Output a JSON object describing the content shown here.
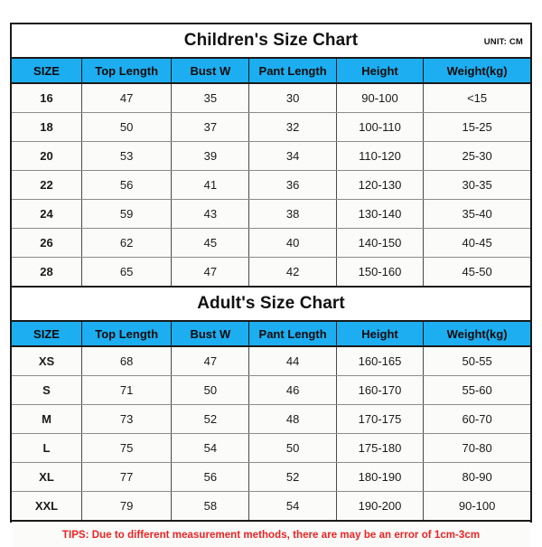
{
  "document": {
    "unit_label": "UNIT: CM",
    "tips": "TIPS: Due to different measurement methods, there are may be an error of 1cm-3cm",
    "accent_color": "#1CAEF0",
    "tips_color": "#EE2222",
    "border_color": "#1A1A1A"
  },
  "children_chart": {
    "title": "Children's Size Chart",
    "columns": [
      "SIZE",
      "Top Length",
      "Bust W",
      "Pant Length",
      "Height",
      "Weight(kg)"
    ],
    "rows": [
      [
        "16",
        "47",
        "35",
        "30",
        "90-100",
        "<15"
      ],
      [
        "18",
        "50",
        "37",
        "32",
        "100-110",
        "15-25"
      ],
      [
        "20",
        "53",
        "39",
        "34",
        "110-120",
        "25-30"
      ],
      [
        "22",
        "56",
        "41",
        "36",
        "120-130",
        "30-35"
      ],
      [
        "24",
        "59",
        "43",
        "38",
        "130-140",
        "35-40"
      ],
      [
        "26",
        "62",
        "45",
        "40",
        "140-150",
        "40-45"
      ],
      [
        "28",
        "65",
        "47",
        "42",
        "150-160",
        "45-50"
      ]
    ]
  },
  "adult_chart": {
    "title": "Adult's Size Chart",
    "columns": [
      "SIZE",
      "Top Length",
      "Bust W",
      "Pant Length",
      "Height",
      "Weight(kg)"
    ],
    "rows": [
      [
        "XS",
        "68",
        "47",
        "44",
        "160-165",
        "50-55"
      ],
      [
        "S",
        "71",
        "50",
        "46",
        "160-170",
        "55-60"
      ],
      [
        "M",
        "73",
        "52",
        "48",
        "170-175",
        "60-70"
      ],
      [
        "L",
        "75",
        "54",
        "50",
        "175-180",
        "70-80"
      ],
      [
        "XL",
        "77",
        "56",
        "52",
        "180-190",
        "80-90"
      ],
      [
        "XXL",
        "79",
        "58",
        "54",
        "190-200",
        "90-100"
      ]
    ]
  }
}
